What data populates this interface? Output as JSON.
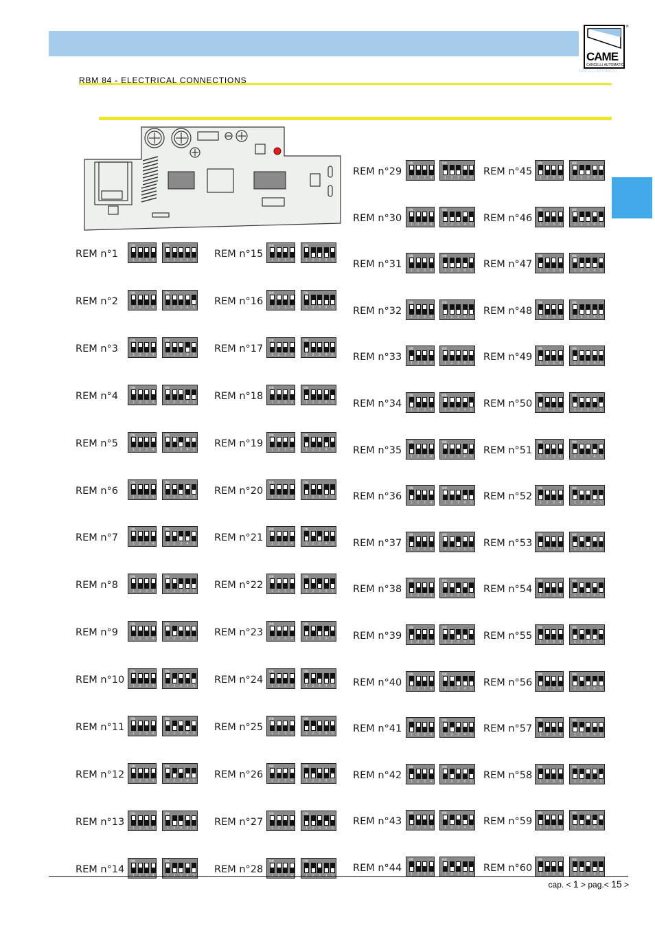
{
  "header": {
    "section_title": "RBM 84 - ELECTRICAL CONNECTIONS",
    "logo_word": "CAME",
    "logo_sub": "CANCELLI AUTOMATICI",
    "logo_reg": "®"
  },
  "colors": {
    "banner": "#a6cbeb",
    "accent_yellow": "#ece92a",
    "side_tab": "#42a9e8"
  },
  "dip_on_label": "ON",
  "footer": {
    "cap_prefix": "cap. < ",
    "cap": "1",
    "mid": " > pag.< ",
    "page": "15",
    "suffix": " >"
  },
  "remotes": []
}
